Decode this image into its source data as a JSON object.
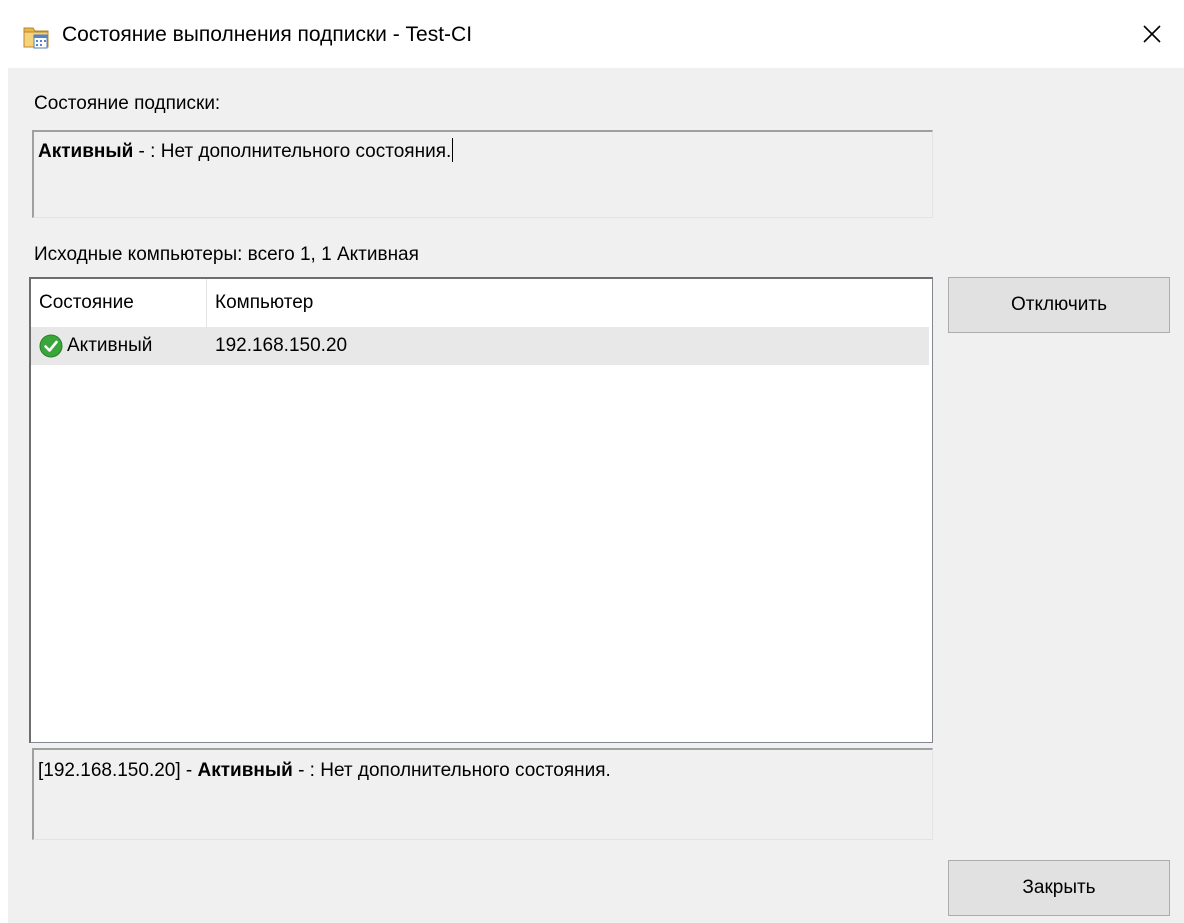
{
  "window": {
    "title": "Состояние выполнения подписки - Test-CI"
  },
  "subscription_status": {
    "label": "Состояние подписки:",
    "state": "Активный",
    "text": " - : Нет дополнительного состояния."
  },
  "source_computers": {
    "label": "Исходные компьютеры: всего 1, 1 Активная",
    "columns": [
      "Состояние",
      "Компьютер"
    ],
    "rows": [
      {
        "state": "Активный",
        "computer": "192.168.150.20"
      }
    ]
  },
  "detail": {
    "address": "[192.168.150.20] - ",
    "state": "Активный",
    "text": " - : Нет дополнительного состояния."
  },
  "buttons": {
    "disable": "Отключить",
    "close": "Закрыть"
  },
  "colors": {
    "client_bg": "#f0f0f0",
    "selected_row": "#e8e8e8",
    "button_bg": "#e1e1e1",
    "status_ok": "#3aa63a"
  },
  "icons": {
    "title": "event-viewer-subscription-icon",
    "close": "close-icon",
    "row_status": "green-check-icon"
  }
}
